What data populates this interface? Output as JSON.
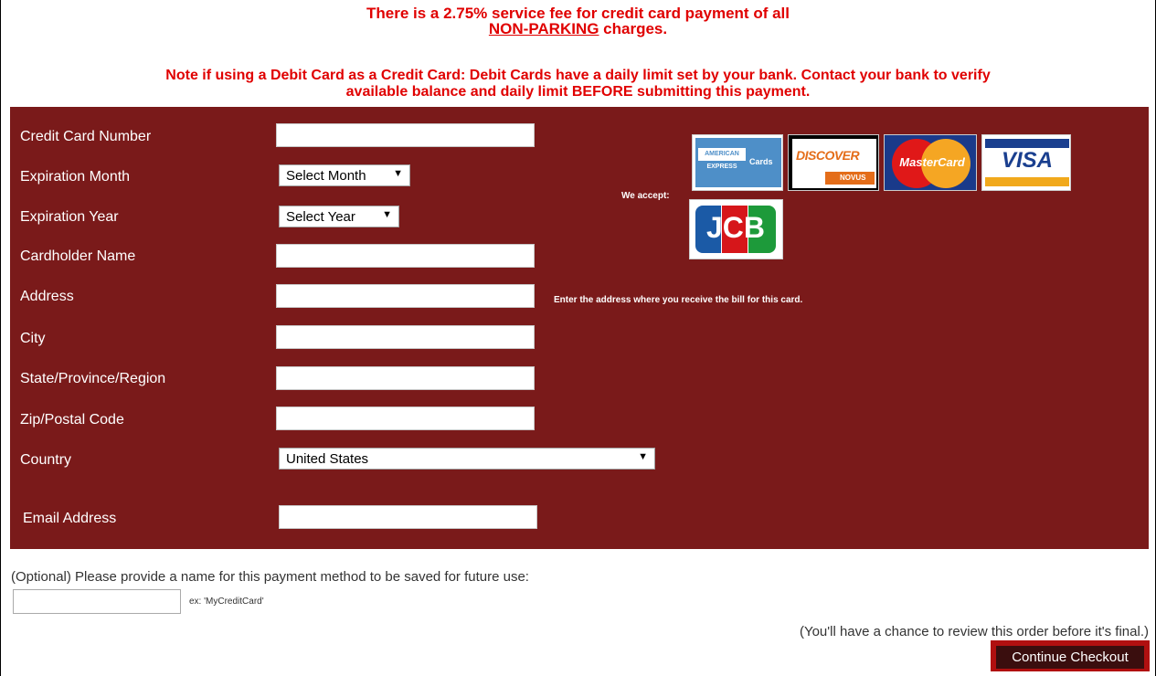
{
  "header": {
    "fee_line1": "There is a 2.75% service fee for credit card payment of all",
    "fee_line2_link": "NON-PARKING",
    "fee_line2_rest": " charges.",
    "note_line1": "Note if using a Debit Card as a Credit Card: Debit Cards have a daily limit set by your bank. Contact your bank to verify",
    "note_line2": "available balance and daily limit BEFORE submitting this payment."
  },
  "form": {
    "card_number_label": "Credit Card Number",
    "exp_month_label": "Expiration Month",
    "exp_month_value": "Select Month",
    "exp_year_label": "Expiration Year",
    "exp_year_value": "Select Year",
    "cardholder_label": "Cardholder Name",
    "address_label": "Address",
    "address_hint": "Enter the address where you receive the bill for this card.",
    "city_label": "City",
    "state_label": "State/Province/Region",
    "zip_label": "Zip/Postal Code",
    "country_label": "Country",
    "country_value": "United States",
    "email_label": "Email Address",
    "we_accept": "We accept:"
  },
  "cards": {
    "amex_line1": "AMERICAN",
    "amex_line2": "EXPRESS",
    "amex_line3": "Cards",
    "discover": "DISCOVER",
    "discover_sub": "NOVUS",
    "mastercard": "MasterCard",
    "visa": "VISA",
    "jcb": "JCB"
  },
  "footer": {
    "optional_text": "(Optional) Please provide a name for this payment method to be saved for future use:",
    "example": "ex: 'MyCreditCard'",
    "review_note": "(You'll have a chance to review this order before it's final.)",
    "continue_button": "Continue Checkout"
  },
  "colors": {
    "panel": "#7a1a1a",
    "alert_red": "#e00000",
    "button_bg": "#3a0e0e",
    "button_border": "#b01010"
  }
}
